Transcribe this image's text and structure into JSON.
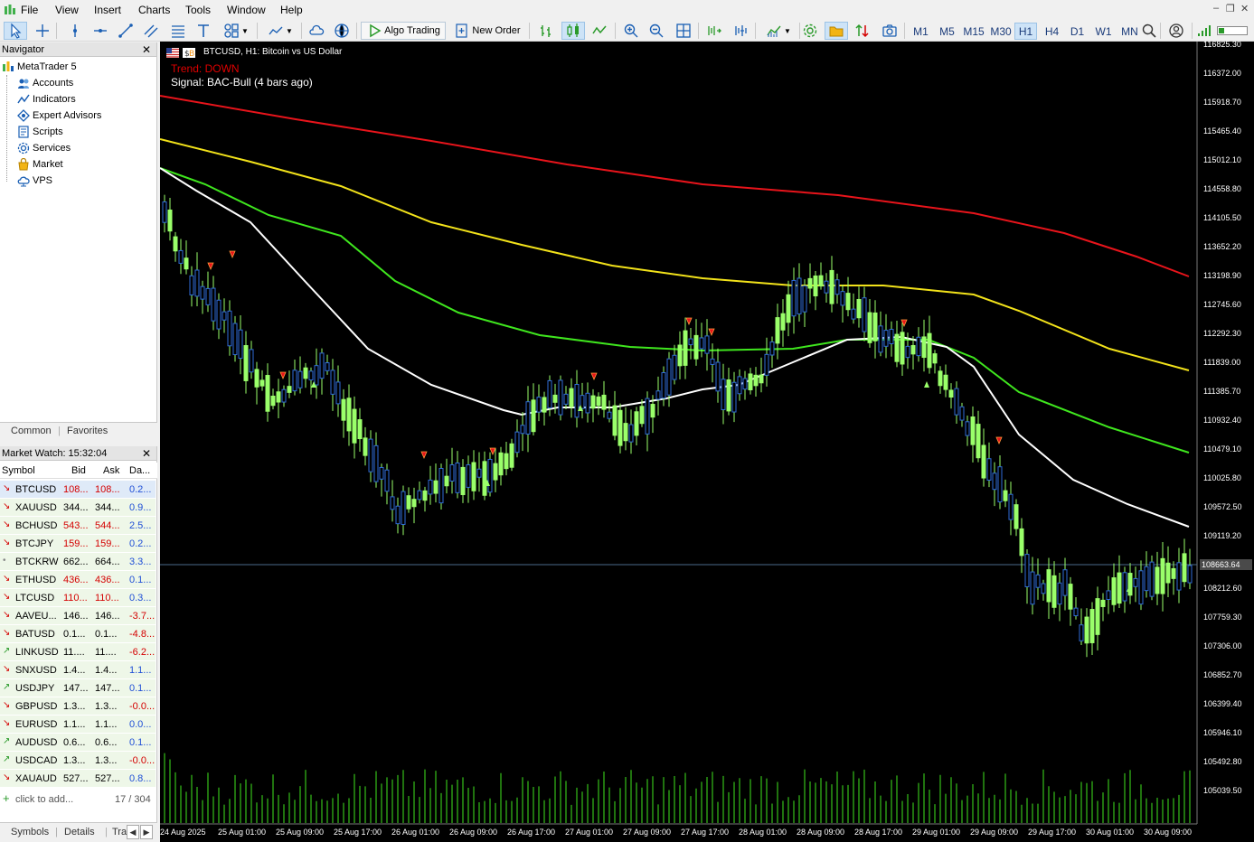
{
  "menu": [
    "File",
    "View",
    "Insert",
    "Charts",
    "Tools",
    "Window",
    "Help"
  ],
  "toolbar": {
    "algo_trading": "Algo Trading",
    "new_order": "New Order",
    "timeframes": [
      "M1",
      "M5",
      "M15",
      "M30",
      "H1",
      "H4",
      "D1",
      "W1",
      "MN"
    ],
    "active_timeframe": "H1"
  },
  "navigator": {
    "title": "Navigator",
    "root": "MetaTrader 5",
    "items": [
      {
        "label": "Accounts",
        "icon": "accounts-icon"
      },
      {
        "label": "Indicators",
        "icon": "indicators-icon"
      },
      {
        "label": "Expert Advisors",
        "icon": "expert-advisors-icon"
      },
      {
        "label": "Scripts",
        "icon": "scripts-icon"
      },
      {
        "label": "Services",
        "icon": "services-icon"
      },
      {
        "label": "Market",
        "icon": "market-icon"
      },
      {
        "label": "VPS",
        "icon": "vps-icon"
      }
    ],
    "tabs": [
      "Common",
      "Favorites"
    ]
  },
  "market_watch": {
    "title": "Market Watch: 15:32:04",
    "columns": [
      "Symbol",
      "Bid",
      "Ask",
      "Da..."
    ],
    "rows": [
      {
        "symbol": "BTCUSD",
        "bid": "108...",
        "ask": "108...",
        "day": "0.2...",
        "dir": "down",
        "color": "red",
        "neg": false
      },
      {
        "symbol": "XAUUSD",
        "bid": "344...",
        "ask": "344...",
        "day": "0.9...",
        "dir": "down",
        "color": "black",
        "neg": false
      },
      {
        "symbol": "BCHUSD",
        "bid": "543...",
        "ask": "544...",
        "day": "2.5...",
        "dir": "down",
        "color": "red",
        "neg": false
      },
      {
        "symbol": "BTCJPY",
        "bid": "159...",
        "ask": "159...",
        "day": "0.2...",
        "dir": "down",
        "color": "red",
        "neg": false
      },
      {
        "symbol": "BTCKRW",
        "bid": "662...",
        "ask": "664...",
        "day": "3.3...",
        "dir": "flat",
        "color": "black",
        "neg": false
      },
      {
        "symbol": "ETHUSD",
        "bid": "436...",
        "ask": "436...",
        "day": "0.1...",
        "dir": "down",
        "color": "red",
        "neg": false
      },
      {
        "symbol": "LTCUSD",
        "bid": "110...",
        "ask": "110...",
        "day": "0.3...",
        "dir": "down",
        "color": "red",
        "neg": false
      },
      {
        "symbol": "AAVEU...",
        "bid": "146...",
        "ask": "146...",
        "day": "-3.7...",
        "dir": "down",
        "color": "black",
        "neg": true
      },
      {
        "symbol": "BATUSD",
        "bid": "0.1...",
        "ask": "0.1...",
        "day": "-4.8...",
        "dir": "down",
        "color": "black",
        "neg": true
      },
      {
        "symbol": "LINKUSD",
        "bid": "11....",
        "ask": "11....",
        "day": "-6.2...",
        "dir": "up",
        "color": "black",
        "neg": true
      },
      {
        "symbol": "SNXUSD",
        "bid": "1.4...",
        "ask": "1.4...",
        "day": "1.1...",
        "dir": "down",
        "color": "black",
        "neg": false
      },
      {
        "symbol": "USDJPY",
        "bid": "147...",
        "ask": "147...",
        "day": "0.1...",
        "dir": "up",
        "color": "black",
        "neg": false
      },
      {
        "symbol": "GBPUSD",
        "bid": "1.3...",
        "ask": "1.3...",
        "day": "-0.0...",
        "dir": "down",
        "color": "black",
        "neg": true
      },
      {
        "symbol": "EURUSD",
        "bid": "1.1...",
        "ask": "1.1...",
        "day": "0.0...",
        "dir": "down",
        "color": "black",
        "neg": false
      },
      {
        "symbol": "AUDUSD",
        "bid": "0.6...",
        "ask": "0.6...",
        "day": "0.1...",
        "dir": "up",
        "color": "black",
        "neg": false
      },
      {
        "symbol": "USDCAD",
        "bid": "1.3...",
        "ask": "1.3...",
        "day": "-0.0...",
        "dir": "up",
        "color": "black",
        "neg": true
      },
      {
        "symbol": "XAUAUD",
        "bid": "527...",
        "ask": "527...",
        "day": "0.8...",
        "dir": "down",
        "color": "black",
        "neg": false
      }
    ],
    "add_label": "click to add...",
    "count": "17 / 304",
    "tabs": [
      "Symbols",
      "Details",
      "Tra"
    ]
  },
  "chart": {
    "title": "BTCUSD, H1:  Bitcoin vs US Dollar",
    "trend": "Trend: DOWN",
    "signal": "Signal: BAC-Bull (4 bars ago)",
    "current_price": "108663.64",
    "price_axis": [
      "116825.30",
      "116372.00",
      "115918.70",
      "115465.40",
      "115012.10",
      "114558.80",
      "114105.50",
      "113652.20",
      "113198.90",
      "112745.60",
      "112292.30",
      "111839.00",
      "111385.70",
      "110932.40",
      "110479.10",
      "110025.80",
      "109572.50",
      "109119.20",
      "108212.60",
      "107759.30",
      "107306.00",
      "106852.70",
      "106399.40",
      "105946.10",
      "105492.80",
      "105039.50"
    ],
    "time_axis": [
      "24 Aug 2025",
      "25 Aug 01:00",
      "25 Aug 09:00",
      "25 Aug 17:00",
      "26 Aug 01:00",
      "26 Aug 09:00",
      "26 Aug 17:00",
      "27 Aug 01:00",
      "27 Aug 09:00",
      "27 Aug 17:00",
      "28 Aug 01:00",
      "28 Aug 09:00",
      "28 Aug 17:00",
      "29 Aug 01:00",
      "29 Aug 09:00",
      "29 Aug 17:00",
      "30 Aug 01:00",
      "30 Aug 09:00"
    ],
    "colors": {
      "ma_red": "#e8141b",
      "ma_yellow": "#f2e21a",
      "ma_green": "#3fe61e",
      "ma_white": "#ffffff",
      "bull": "#9aff6a",
      "bear": "#2f6bd8",
      "volume": "#3fe61e",
      "trend_text": "#e00000"
    }
  }
}
